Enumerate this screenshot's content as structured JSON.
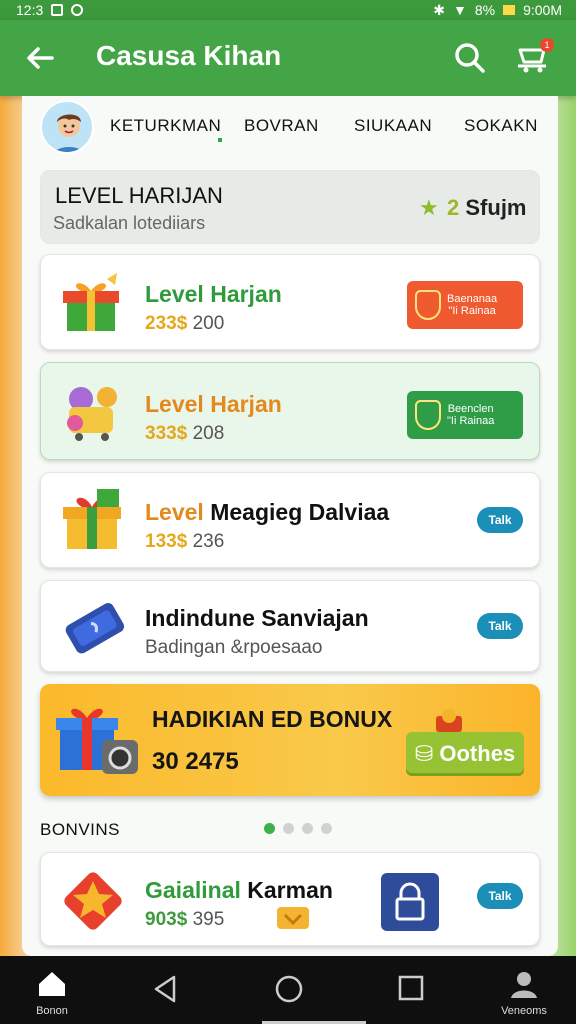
{
  "status_bar": {
    "time_left": "12:3",
    "battery": "8%",
    "time_right": "9:00M"
  },
  "app_bar": {
    "title": "Casusa Kihan",
    "back_icon": "arrow-left-icon",
    "search_icon": "search-icon",
    "cart_icon": "cart-icon",
    "cart_badge": "1"
  },
  "tabs": [
    {
      "label": "KETURKMAN"
    },
    {
      "label": "BOVRAN"
    },
    {
      "label": "SIUKAAN"
    },
    {
      "label": "SOKAKN"
    }
  ],
  "header": {
    "title": "LEVEL HARIJAN",
    "subtitle": "Sadkalan lotediiars",
    "count": "2",
    "count_unit": "Sfujm"
  },
  "items": [
    {
      "title": "Level Harjan",
      "price": "233$",
      "amount": "200",
      "button_line1": "Baenanaa",
      "button_line2": "\"Ii Rainaa",
      "button_color": "#ef5a30",
      "title_color": "#2f9b3a"
    },
    {
      "title": "Level Harjan",
      "price": "333$",
      "amount": "208",
      "button_line1": "Beenclen",
      "button_line2": "\"Ii Rainaa",
      "button_color": "#2f9d48",
      "title_color": "#e48a1c"
    },
    {
      "title_prefix": "Level",
      "title": "Meagieg Dalviaa",
      "price": "133$",
      "amount": "236",
      "pill": "Talk"
    },
    {
      "title": "Indindune Sanviajan",
      "subtitle": "Badingan &rpoesaao",
      "pill": "Talk"
    }
  ],
  "bonus": {
    "title": "HADIKIAN ED BONUX",
    "value": "30 2475",
    "button": "Oothes",
    "button_icon": "coin-icon"
  },
  "section": {
    "label": "BONVINS"
  },
  "last_item": {
    "title_prefix": "Gaialinal",
    "title": "Karman",
    "price": "903$",
    "amount": "395",
    "pill": "Talk"
  },
  "nav": {
    "home_label": "Bonon",
    "profile_label": "Veneoms"
  },
  "colors": {
    "brand_green": "#43a546",
    "accent_orange": "#fbb92b",
    "pill_blue": "#1b8fb8"
  }
}
